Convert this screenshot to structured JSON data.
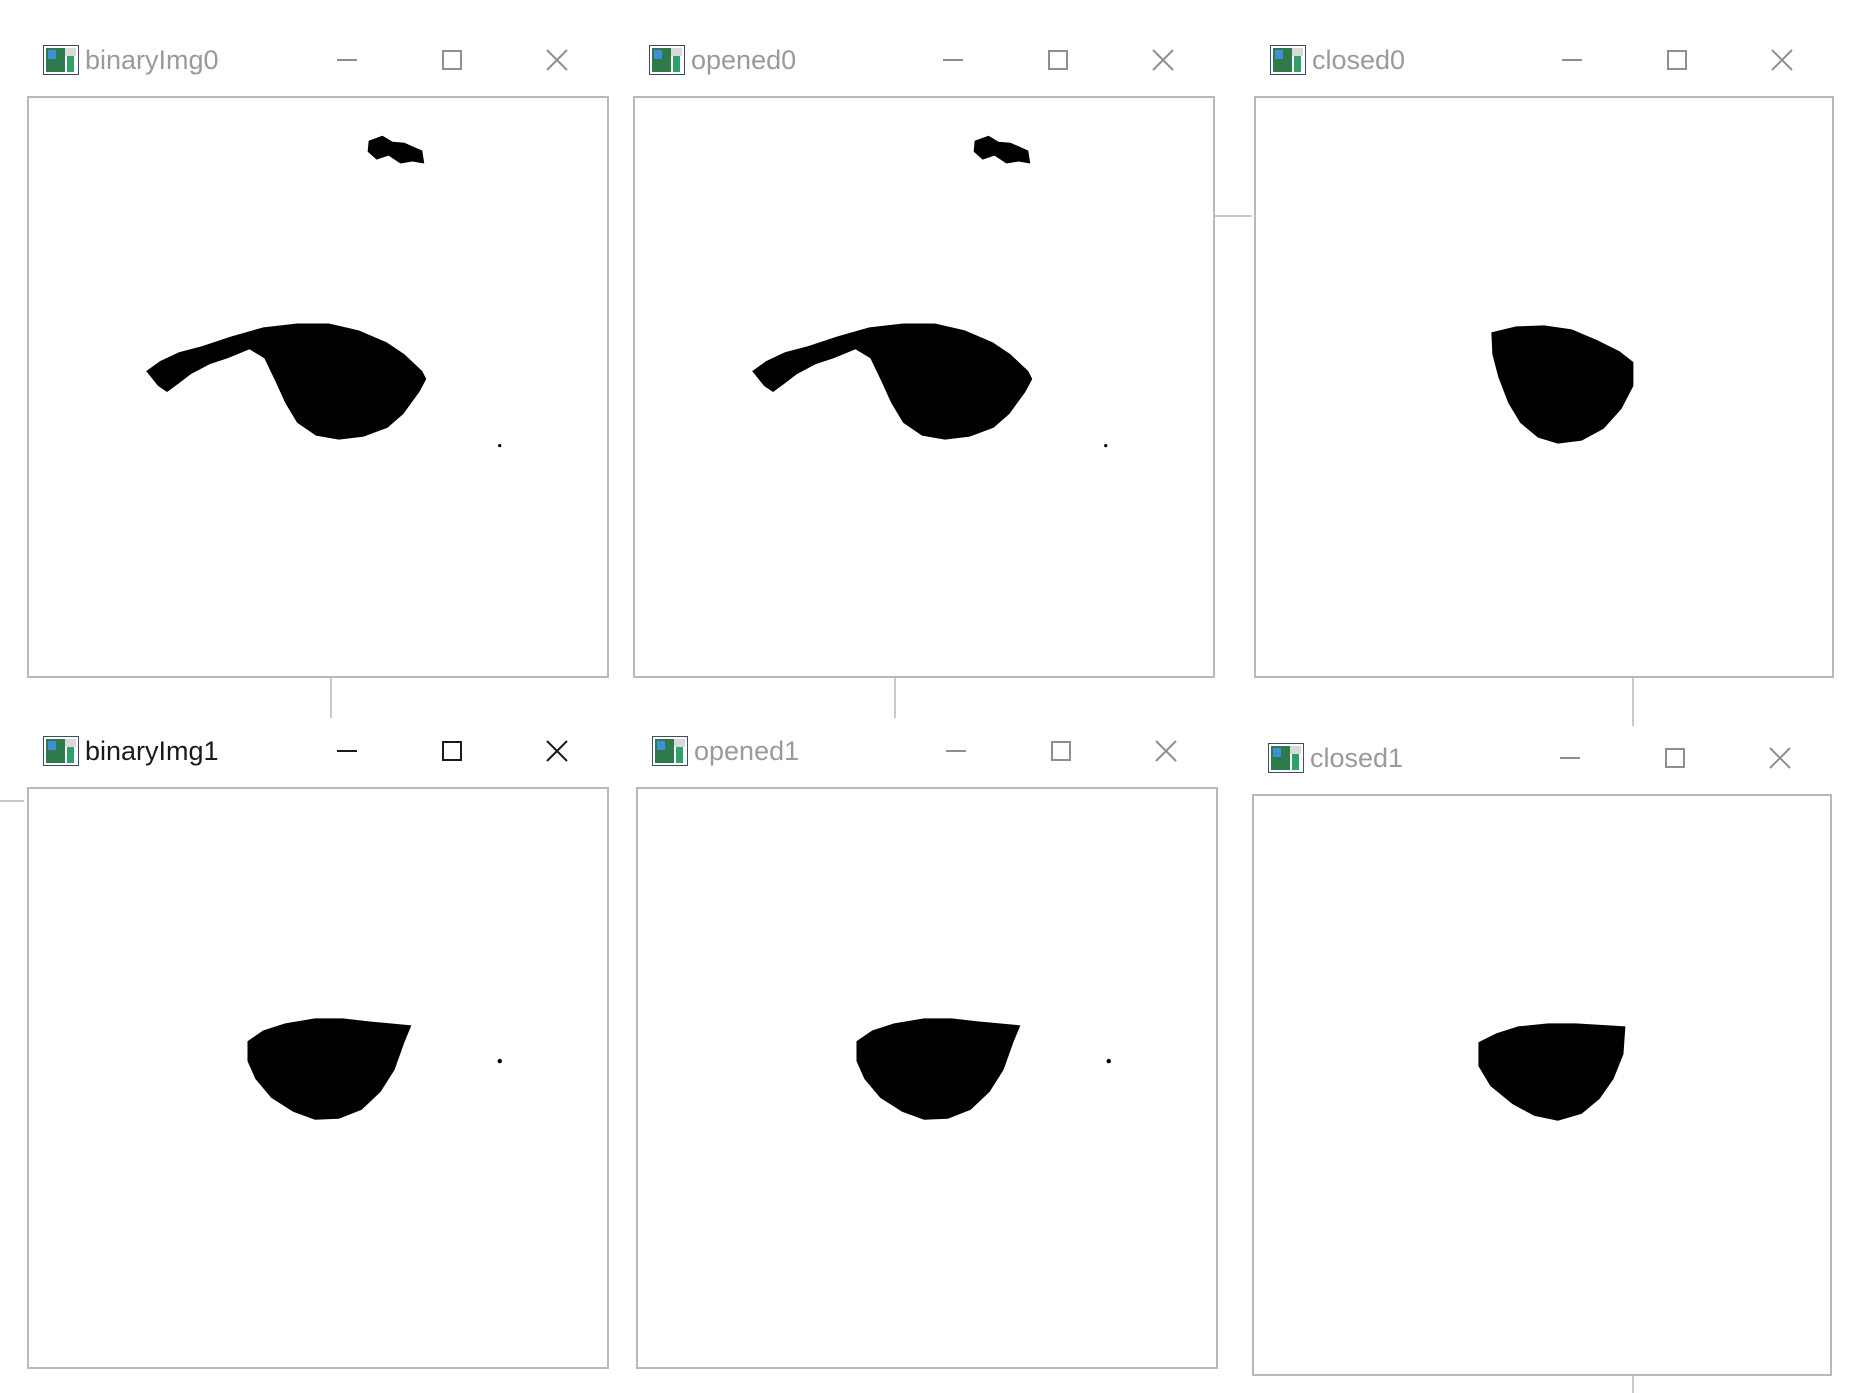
{
  "windows": [
    {
      "id": "binaryImg0",
      "title": "binaryImg0",
      "active": false
    },
    {
      "id": "opened0",
      "title": "opened0",
      "active": false
    },
    {
      "id": "closed0",
      "title": "closed0",
      "active": false
    },
    {
      "id": "binaryImg1",
      "title": "binaryImg1",
      "active": true
    },
    {
      "id": "opened1",
      "title": "opened1",
      "active": false
    },
    {
      "id": "closed1",
      "title": "closed1",
      "active": false
    }
  ],
  "icons": {
    "app": "image-window-icon",
    "minimize": "minimize-icon",
    "maximize": "maximize-icon",
    "close": "close-icon"
  },
  "colors": {
    "inactive_text": "#9a9a9a",
    "active_text": "#1a1a1a",
    "mask_fg": "#000000",
    "mask_bg": "#ffffff"
  }
}
